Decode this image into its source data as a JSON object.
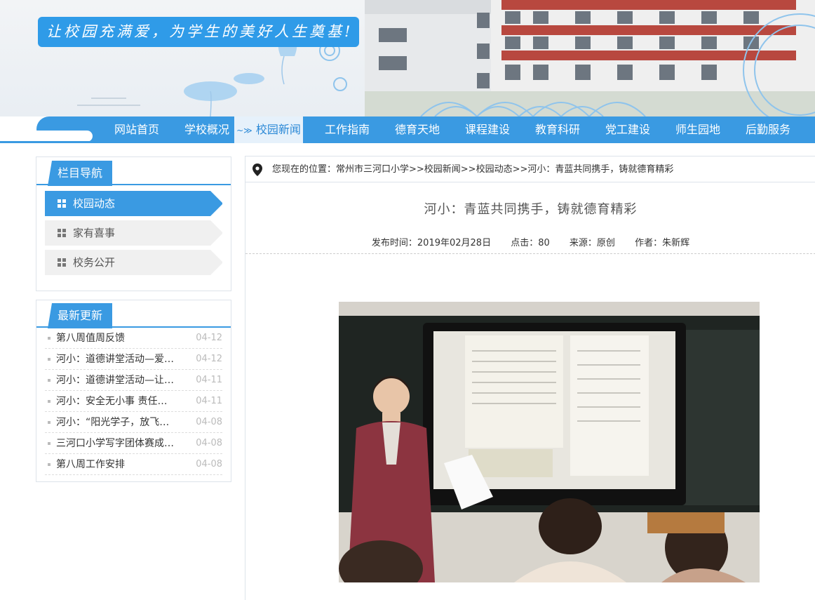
{
  "banner": {
    "slogan": "让校园充满爱，为学生的美好人生奠基!"
  },
  "nav": {
    "items": [
      "网站首页",
      "学校概况",
      "校园新闻",
      "工作指南",
      "德育天地",
      "课程建设",
      "教育科研",
      "党工建设",
      "师生园地",
      "后勤服务"
    ],
    "active": "校园新闻"
  },
  "sidebar": {
    "nav_title": "栏目导航",
    "categories": [
      {
        "label": "校园动态",
        "active": true
      },
      {
        "label": "家有喜事",
        "active": false
      },
      {
        "label": "校务公开",
        "active": false
      }
    ],
    "latest_title": "最新更新",
    "latest": [
      {
        "title": "第八周值周反馈",
        "date": "04-12"
      },
      {
        "title": "河小：道德讲堂活动—爱…",
        "date": "04-12"
      },
      {
        "title": "河小：道德讲堂活动—让…",
        "date": "04-11"
      },
      {
        "title": "河小：安全无小事 责任…",
        "date": "04-11"
      },
      {
        "title": "河小：“阳光学子，放飞…",
        "date": "04-08"
      },
      {
        "title": "三河口小学写字团体赛成…",
        "date": "04-08"
      },
      {
        "title": "第八周工作安排",
        "date": "04-08"
      }
    ]
  },
  "breadcrumb": "您现在的位置：常州市三河口小学>>校园新闻>>校园动态>>河小：青蓝共同携手，铸就德育精彩",
  "article": {
    "title": "河小：青蓝共同携手，铸就德育精彩",
    "publish": "发布时间：2019年02月28日",
    "clicks": "点击：80",
    "source": "来源：原创",
    "author": "作者：朱新辉"
  },
  "colors": {
    "primary_blue": "#3a9ae2",
    "slogan_blue": "#2f9be8",
    "active_nav_bg": "#e6f1fb"
  },
  "icons": [
    "location-pin-icon",
    "grid-square-icon",
    "bullet-dot-icon"
  ]
}
